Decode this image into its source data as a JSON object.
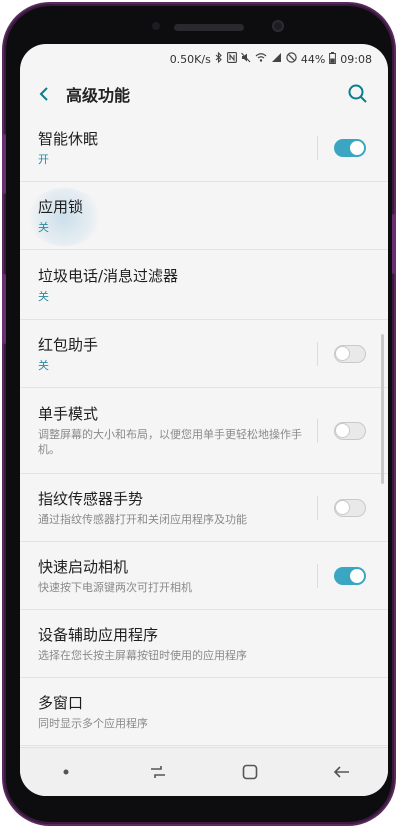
{
  "statusbar": {
    "speed": "0.50K/s",
    "battery": "44%",
    "time": "09:08"
  },
  "appbar": {
    "title": "高级功能"
  },
  "items": [
    {
      "title": "智能休眠",
      "sub": "开",
      "sub_style": "accent",
      "toggle": "on"
    },
    {
      "title": "应用锁",
      "sub": "关",
      "sub_style": "accent",
      "toggle": "none"
    },
    {
      "title": "垃圾电话/消息过滤器",
      "sub": "关",
      "sub_style": "accent",
      "toggle": "none"
    },
    {
      "title": "红包助手",
      "sub": "关",
      "sub_style": "accent",
      "toggle": "off"
    },
    {
      "title": "单手模式",
      "sub": "调整屏幕的大小和布局，以便您用单手更轻松地操作手机。",
      "sub_style": "grey",
      "toggle": "off"
    },
    {
      "title": "指纹传感器手势",
      "sub": "通过指纹传感器打开和关闭应用程序及功能",
      "sub_style": "grey",
      "toggle": "off"
    },
    {
      "title": "快速启动相机",
      "sub": "快速按下电源键两次可打开相机",
      "sub_style": "grey",
      "toggle": "on"
    },
    {
      "title": "设备辅助应用程序",
      "sub": "选择在您长按主屏幕按钮时使用的应用程序",
      "sub_style": "grey",
      "toggle": "none"
    },
    {
      "title": "多窗口",
      "sub": "同时显示多个应用程序",
      "sub_style": "grey",
      "toggle": "none"
    }
  ],
  "colors": {
    "accent": "#3aa6c2",
    "back_arrow": "#0a7e8a",
    "frame": "#5a2a5e"
  },
  "icons": [
    "back-arrow-icon",
    "search-icon",
    "bluetooth-icon",
    "nfc-icon",
    "mute-icon",
    "wifi-icon",
    "signal-icon",
    "dnd-icon",
    "battery-icon",
    "recent-apps-icon",
    "home-icon",
    "back-nav-icon"
  ]
}
